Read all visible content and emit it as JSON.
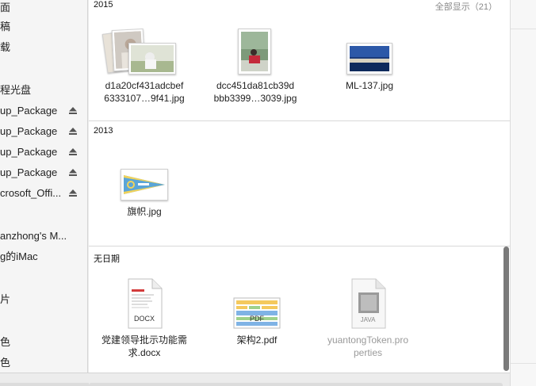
{
  "sidebar": {
    "items": [
      {
        "label": "面"
      },
      {
        "label": "稿"
      },
      {
        "label": "载"
      },
      {
        "label": "程光盘"
      },
      {
        "label": "up_Package",
        "eject": true
      },
      {
        "label": "up_Package",
        "eject": true
      },
      {
        "label": "up_Package",
        "eject": true
      },
      {
        "label": "up_Package",
        "eject": true
      },
      {
        "label": "crosoft_Offi...",
        "eject": true
      },
      {
        "label": "anzhong's M..."
      },
      {
        "label": "g的iMac"
      },
      {
        "label": "片"
      },
      {
        "label": "色"
      },
      {
        "label": "色"
      }
    ]
  },
  "sections": [
    {
      "title": "2015",
      "show_all": "全部显示（21）",
      "files": [
        {
          "name_line1": "d1a20cf431adcbef",
          "name_line2": "6333107…9f41.jpg",
          "icon": "photo-stack-icon"
        },
        {
          "name_line1": "dcc451da81cb39d",
          "name_line2": "bbb3399…3039.jpg",
          "icon": "portrait-photo-icon"
        },
        {
          "name_line1": "ML-137.jpg",
          "name_line2": "",
          "icon": "landscape-photo-icon"
        }
      ]
    },
    {
      "title": "2013",
      "files": [
        {
          "name_line1": "旗帜.jpg",
          "name_line2": "",
          "icon": "pennant-image-icon"
        }
      ]
    },
    {
      "title": "无日期",
      "files": [
        {
          "name_line1": "党建领导批示功能需",
          "name_line2": "求.docx",
          "icon": "docx-document-icon",
          "badge": "DOCX"
        },
        {
          "name_line1": "架构2.pdf",
          "name_line2": "",
          "icon": "pdf-document-icon",
          "badge": "PDF"
        },
        {
          "name_line1": "yuantongToken.pro",
          "name_line2": "perties",
          "icon": "java-file-icon",
          "badge": "JAVA"
        }
      ]
    }
  ],
  "colors": {
    "sidebar_bg": "#f5f5f5",
    "content_bg": "#ffffff",
    "divider": "#d8d8d8",
    "scroll_thumb": "#7a7a7a",
    "pennant_blue": "#5aa5d8",
    "pennant_yellow": "#f1d35a"
  }
}
